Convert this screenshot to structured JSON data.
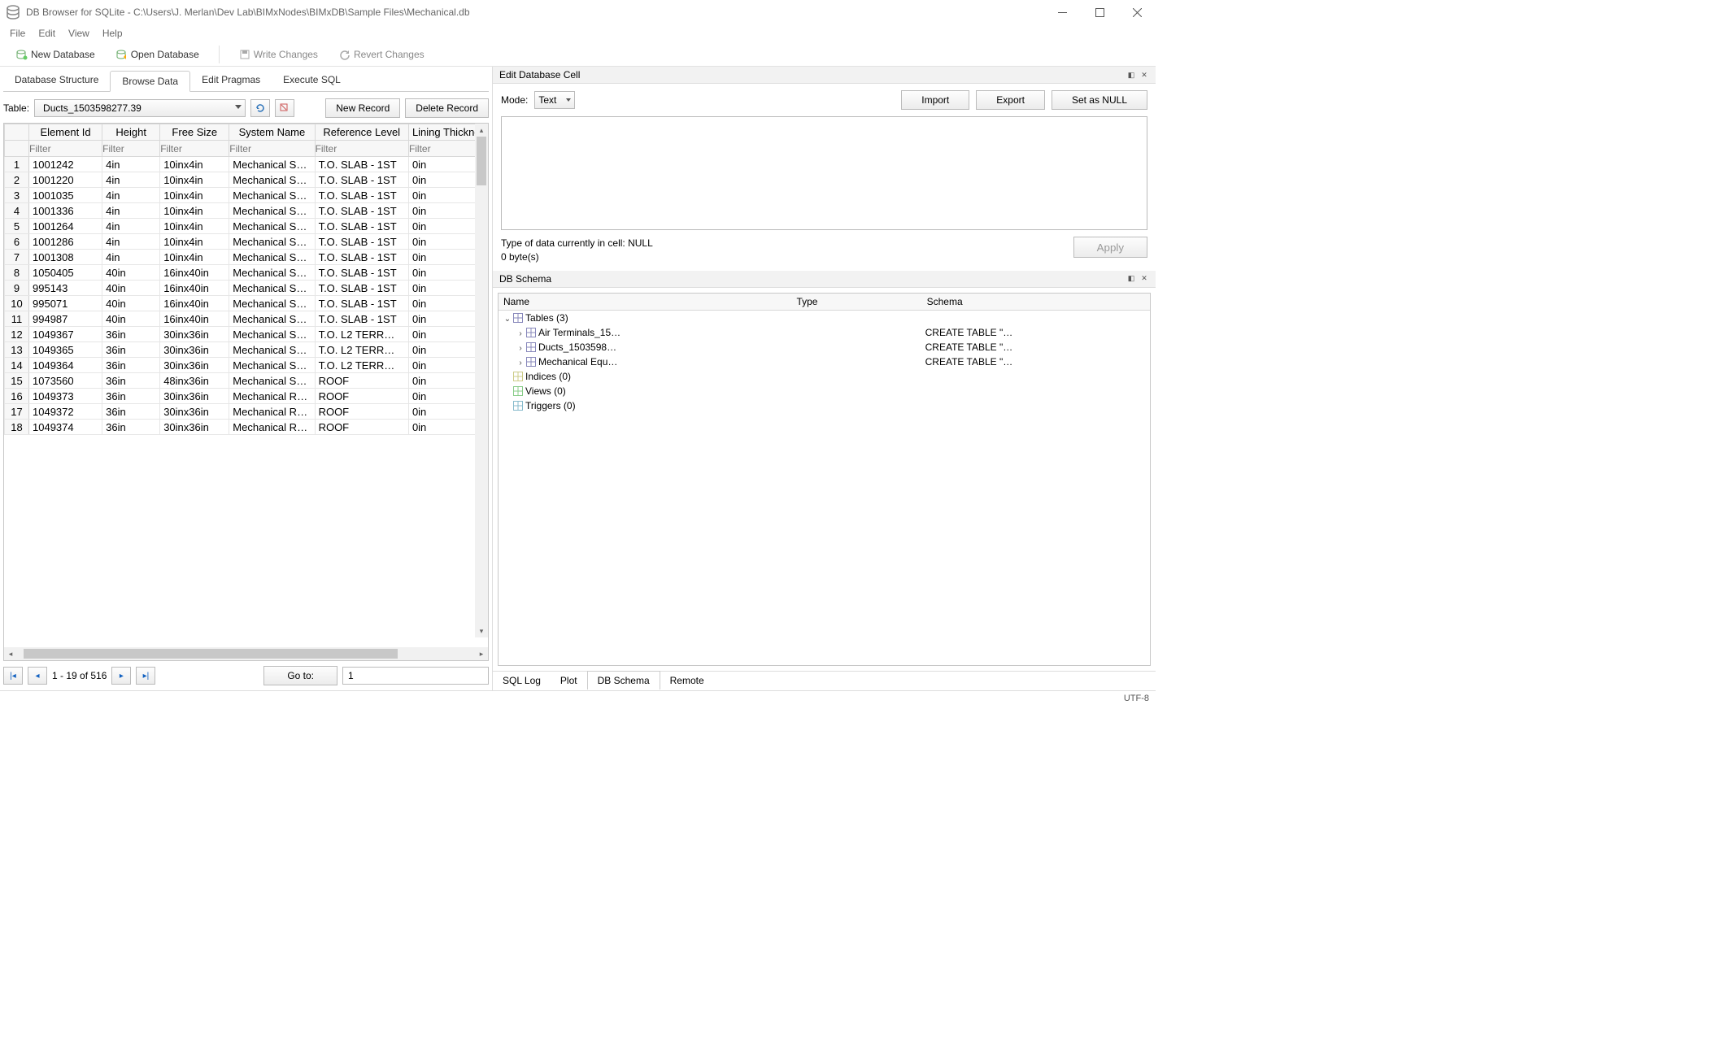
{
  "window": {
    "title": "DB Browser for SQLite - C:\\Users\\J. Merlan\\Dev Lab\\BIMxNodes\\BIMxDB\\Sample Files\\Mechanical.db"
  },
  "menu": [
    "File",
    "Edit",
    "View",
    "Help"
  ],
  "toolbar": {
    "new_db": "New Database",
    "open_db": "Open Database",
    "write": "Write Changes",
    "revert": "Revert Changes"
  },
  "main_tabs": [
    "Database Structure",
    "Browse Data",
    "Edit Pragmas",
    "Execute SQL"
  ],
  "main_tab_active": 1,
  "browse": {
    "table_label": "Table:",
    "table_name": "Ducts_1503598277.39",
    "new_record": "New Record",
    "delete_record": "Delete Record",
    "columns": [
      "Element Id",
      "Height",
      "Free Size",
      "System Name",
      "Reference Level",
      "Lining Thickness"
    ],
    "col_display": [
      "Element Id",
      "Height",
      "Free Size",
      "System Name",
      "Reference Level",
      "Lining Thickness"
    ],
    "filter_placeholder": "Filter",
    "rows": [
      [
        "1001242",
        "4in",
        "10inx4in",
        "Mechanical Su…",
        "T.O. SLAB - 1ST",
        "0in"
      ],
      [
        "1001220",
        "4in",
        "10inx4in",
        "Mechanical Su…",
        "T.O. SLAB - 1ST",
        "0in"
      ],
      [
        "1001035",
        "4in",
        "10inx4in",
        "Mechanical Su…",
        "T.O. SLAB - 1ST",
        "0in"
      ],
      [
        "1001336",
        "4in",
        "10inx4in",
        "Mechanical Su…",
        "T.O. SLAB - 1ST",
        "0in"
      ],
      [
        "1001264",
        "4in",
        "10inx4in",
        "Mechanical Su…",
        "T.O. SLAB - 1ST",
        "0in"
      ],
      [
        "1001286",
        "4in",
        "10inx4in",
        "Mechanical Su…",
        "T.O. SLAB - 1ST",
        "0in"
      ],
      [
        "1001308",
        "4in",
        "10inx4in",
        "Mechanical Su…",
        "T.O. SLAB - 1ST",
        "0in"
      ],
      [
        "1050405",
        "40in",
        "16inx40in",
        "Mechanical Su…",
        "T.O. SLAB - 1ST",
        "0in"
      ],
      [
        "995143",
        "40in",
        "16inx40in",
        "Mechanical Su…",
        "T.O. SLAB - 1ST",
        "0in"
      ],
      [
        "995071",
        "40in",
        "16inx40in",
        "Mechanical Su…",
        "T.O. SLAB - 1ST",
        "0in"
      ],
      [
        "994987",
        "40in",
        "16inx40in",
        "Mechanical Su…",
        "T.O. SLAB - 1ST",
        "0in"
      ],
      [
        "1049367",
        "36in",
        "30inx36in",
        "Mechanical Su…",
        "T.O. L2 TERR…",
        "0in"
      ],
      [
        "1049365",
        "36in",
        "30inx36in",
        "Mechanical Su…",
        "T.O. L2 TERR…",
        "0in"
      ],
      [
        "1049364",
        "36in",
        "30inx36in",
        "Mechanical Su…",
        "T.O. L2 TERR…",
        "0in"
      ],
      [
        "1073560",
        "36in",
        "48inx36in",
        "Mechanical Su…",
        "ROOF",
        "0in"
      ],
      [
        "1049373",
        "36in",
        "30inx36in",
        "Mechanical Re…",
        "ROOF",
        "0in"
      ],
      [
        "1049372",
        "36in",
        "30inx36in",
        "Mechanical Re…",
        "ROOF",
        "0in"
      ],
      [
        "1049374",
        "36in",
        "30inx36in",
        "Mechanical Re…",
        "ROOF",
        "0in"
      ]
    ],
    "nav_text": "1 - 19 of 516",
    "goto_label": "Go to:",
    "goto_value": "1"
  },
  "edit_cell": {
    "title": "Edit Database Cell",
    "mode_label": "Mode:",
    "mode_value": "Text",
    "import": "Import",
    "export": "Export",
    "set_null": "Set as NULL",
    "info_type": "Type of data currently in cell: NULL",
    "info_size": "0 byte(s)",
    "apply": "Apply"
  },
  "schema": {
    "title": "DB Schema",
    "columns": [
      "Name",
      "Type",
      "Schema"
    ],
    "tables_label": "Tables (3)",
    "tables": [
      {
        "name": "Air Terminals_15…",
        "schema": "CREATE TABLE \"…"
      },
      {
        "name": "Ducts_1503598…",
        "schema": "CREATE TABLE \"…"
      },
      {
        "name": "Mechanical Equ…",
        "schema": "CREATE TABLE \"…"
      }
    ],
    "indices": "Indices (0)",
    "views": "Views (0)",
    "triggers": "Triggers (0)"
  },
  "bottom_tabs": [
    "SQL Log",
    "Plot",
    "DB Schema",
    "Remote"
  ],
  "bottom_tab_active": 2,
  "status": {
    "encoding": "UTF-8"
  }
}
